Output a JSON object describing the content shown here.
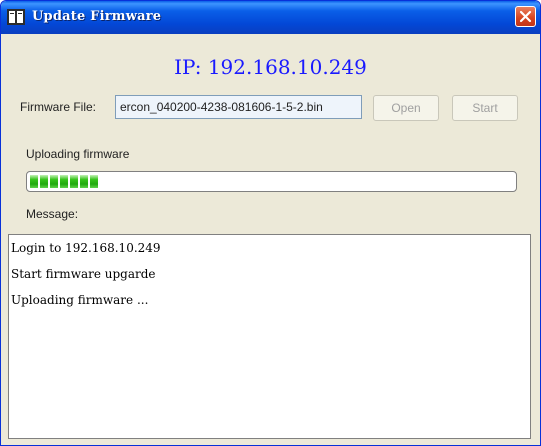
{
  "window": {
    "title": "Update Firmware"
  },
  "ip_line": "IP: 192.168.10.249",
  "firmware": {
    "label": "Firmware File:",
    "value": "ercon_040200-4238-081606-1-5-2.bin",
    "open_label": "Open",
    "start_label": "Start"
  },
  "upload": {
    "status": "Uploading firmware",
    "progress": 0.15
  },
  "message": {
    "label": "Message:",
    "lines": [
      "Login to 192.168.10.249",
      "Start firmware upgarde",
      "Uploading firmware ..."
    ]
  },
  "colors": {
    "titlebar": "#0a5fe8",
    "ip_text": "#1a1aff",
    "progress": "#22a90f"
  },
  "icons": {
    "app": "app-window-icon",
    "close": "close-icon"
  }
}
